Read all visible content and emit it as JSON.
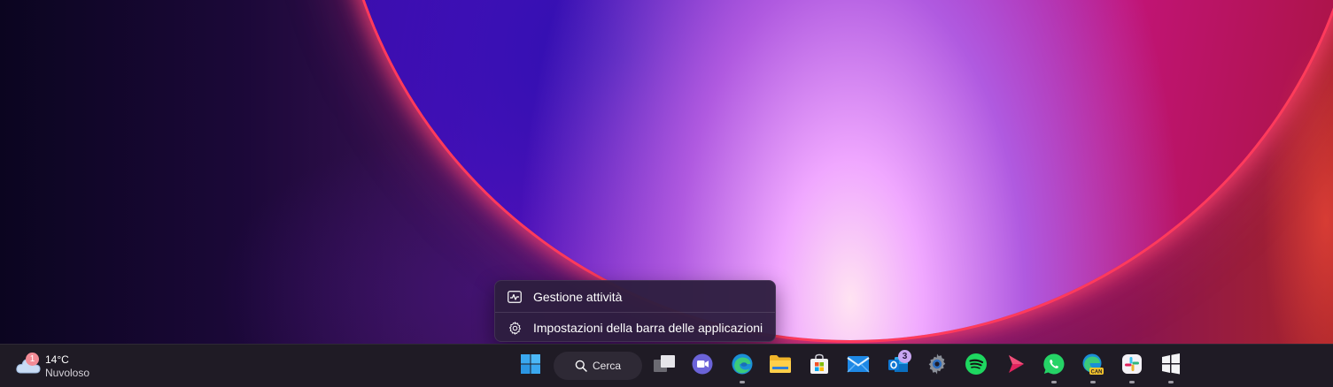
{
  "context_menu": {
    "items": [
      {
        "label": "Gestione attività",
        "icon": "task-manager-icon"
      },
      {
        "label": "Impostazioni della barra delle applicazioni",
        "icon": "gear-icon"
      }
    ]
  },
  "weather": {
    "temperature": "14°C",
    "condition": "Nuvoloso",
    "badge_count": "1",
    "icon": "cloud-icon"
  },
  "taskbar": {
    "search_label": "Cerca",
    "apps": [
      {
        "name": "start-button",
        "icon": "windows-logo-icon",
        "running": false
      },
      {
        "name": "task-view",
        "icon": "task-view-icon",
        "running": false
      },
      {
        "name": "teams-chat",
        "icon": "video-chat-icon",
        "running": false
      },
      {
        "name": "edge",
        "icon": "edge-icon",
        "running": true
      },
      {
        "name": "file-explorer",
        "icon": "folder-icon",
        "running": false
      },
      {
        "name": "store",
        "icon": "store-icon",
        "running": false
      },
      {
        "name": "mail",
        "icon": "mail-icon",
        "running": false
      },
      {
        "name": "outlook",
        "icon": "outlook-icon",
        "running": false,
        "badge": "3"
      },
      {
        "name": "settings",
        "icon": "gear-icon",
        "running": false
      },
      {
        "name": "spotify",
        "icon": "spotify-icon",
        "running": false
      },
      {
        "name": "media-player",
        "icon": "play-icon",
        "running": false
      },
      {
        "name": "whatsapp",
        "icon": "whatsapp-icon",
        "running": true
      },
      {
        "name": "edge-canary",
        "icon": "edge-canary-icon",
        "running": true,
        "label": "CAN"
      },
      {
        "name": "slack",
        "icon": "slack-icon",
        "running": true
      },
      {
        "name": "snipping-tool",
        "icon": "window-app-icon",
        "running": true
      }
    ]
  },
  "colors": {
    "taskbar_bg": "#1f1b25",
    "menu_bg": "#2e1e40",
    "accent": "#60cdff"
  }
}
